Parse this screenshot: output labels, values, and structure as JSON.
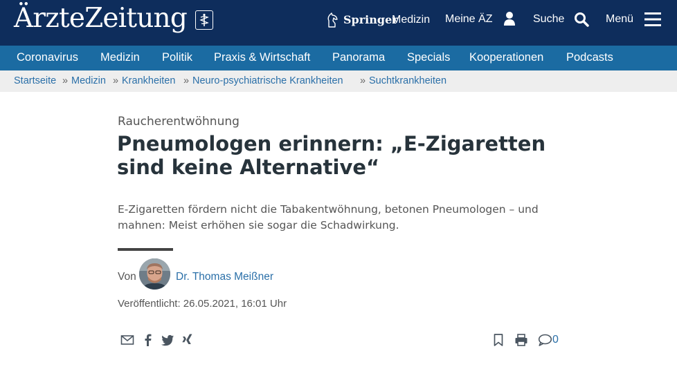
{
  "header": {
    "logo_text": "ÄrzteZeitung",
    "springer_name": "Springer",
    "springer_sub": "Medizin",
    "meine_label": "Meine ÄZ",
    "suche_label": "Suche",
    "menu_label": "Menü",
    "background": "#0e2d5c"
  },
  "nav": {
    "background": "#1b6ba2",
    "items": [
      "Coronavirus",
      "Medizin",
      "Politik",
      "Praxis & Wirtschaft",
      "Panorama",
      "Specials",
      "Kooperationen",
      "Podcasts"
    ]
  },
  "breadcrumb": {
    "items": [
      "Startseite",
      "Medizin",
      "Krankheiten",
      "Neuro-psychiatrische Krankheiten",
      "Suchtkrankheiten"
    ],
    "separator": "»"
  },
  "article": {
    "kicker": "Raucherentwöhnung",
    "title": "Pneumologen erinnern: „E-Zigaretten sind keine Alternative“",
    "lead": "E-Zigaretten fördern nicht die Tabakentwöhnung, betonen Pneumologen – und mahnen: Meist erhöhen sie sogar die Schadwirkung.",
    "by_label": "Von",
    "author": "Dr. Thomas Meißner",
    "published": "Veröffentlicht: 26.05.2021, 16:01 Uhr",
    "comment_count": "0"
  },
  "icons": {
    "share": [
      "email-icon",
      "facebook-icon",
      "twitter-icon",
      "xing-icon"
    ],
    "actions": [
      "bookmark-icon",
      "print-icon",
      "comment-icon"
    ],
    "link_color": "#2a6fa8"
  }
}
